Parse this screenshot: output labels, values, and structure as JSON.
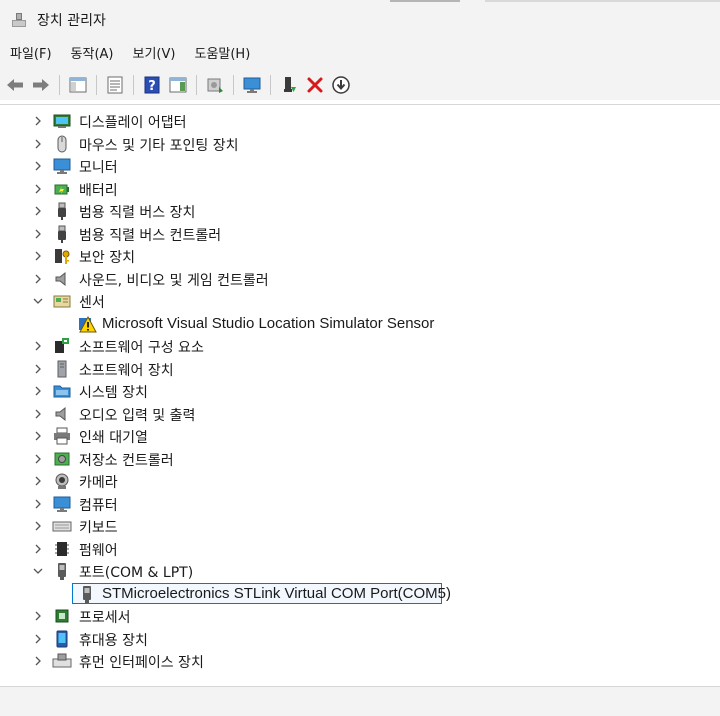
{
  "window": {
    "title": "장치 관리자"
  },
  "menu": {
    "items": [
      "파일(F)",
      "동작(A)",
      "보기(V)",
      "도움말(H)"
    ]
  },
  "toolbar": {
    "buttons": [
      "back-arrow-icon",
      "forward-arrow-icon",
      "show-hide-tree-icon",
      "properties-icon",
      "help-icon",
      "view-pane-icon",
      "scan-hardware-icon",
      "monitor-icon",
      "add-driver-icon",
      "uninstall-x-icon",
      "download-driver-icon"
    ]
  },
  "tree": {
    "nodes": [
      {
        "label": "디스플레이 어댑터",
        "icon": "display-adapter-icon",
        "expanded": false,
        "level": 0
      },
      {
        "label": "마우스 및 기타 포인팅 장치",
        "icon": "mouse-icon",
        "expanded": false,
        "level": 0
      },
      {
        "label": "모니터",
        "icon": "monitor-icon",
        "expanded": false,
        "level": 0
      },
      {
        "label": "배터리",
        "icon": "battery-icon",
        "expanded": false,
        "level": 0
      },
      {
        "label": "범용 직렬 버스 장치",
        "icon": "usb-icon",
        "expanded": false,
        "level": 0
      },
      {
        "label": "범용 직렬 버스 컨트롤러",
        "icon": "usb-icon",
        "expanded": false,
        "level": 0
      },
      {
        "label": "보안 장치",
        "icon": "security-key-icon",
        "expanded": false,
        "level": 0
      },
      {
        "label": "사운드, 비디오 및 게임 컨트롤러",
        "icon": "speaker-icon",
        "expanded": false,
        "level": 0
      },
      {
        "label": "센서",
        "icon": "sensor-icon",
        "expanded": true,
        "level": 0
      },
      {
        "label": "Microsoft Visual Studio Location Simulator Sensor",
        "icon": "warning-sensor-icon",
        "expanded": null,
        "level": 1
      },
      {
        "label": "소프트웨어 구성 요소",
        "icon": "software-component-icon",
        "expanded": false,
        "level": 0
      },
      {
        "label": "소프트웨어 장치",
        "icon": "software-device-icon",
        "expanded": false,
        "level": 0
      },
      {
        "label": "시스템 장치",
        "icon": "system-folder-icon",
        "expanded": false,
        "level": 0
      },
      {
        "label": "오디오 입력 및 출력",
        "icon": "speaker-icon",
        "expanded": false,
        "level": 0
      },
      {
        "label": "인쇄 대기열",
        "icon": "printer-icon",
        "expanded": false,
        "level": 0
      },
      {
        "label": "저장소 컨트롤러",
        "icon": "storage-controller-icon",
        "expanded": false,
        "level": 0
      },
      {
        "label": "카메라",
        "icon": "camera-icon",
        "expanded": false,
        "level": 0
      },
      {
        "label": "컴퓨터",
        "icon": "computer-icon",
        "expanded": false,
        "level": 0
      },
      {
        "label": "키보드",
        "icon": "keyboard-icon",
        "expanded": false,
        "level": 0
      },
      {
        "label": "펌웨어",
        "icon": "firmware-chip-icon",
        "expanded": false,
        "level": 0
      },
      {
        "label": "포트(COM & LPT)",
        "icon": "port-connector-icon",
        "expanded": true,
        "level": 0
      },
      {
        "label": "STMicroelectronics STLink Virtual COM Port(COM5)",
        "icon": "port-connector-icon",
        "expanded": null,
        "level": 1,
        "selected": true
      },
      {
        "label": "프로세서",
        "icon": "processor-icon",
        "expanded": false,
        "level": 0
      },
      {
        "label": "휴대용 장치",
        "icon": "portable-device-icon",
        "expanded": false,
        "level": 0
      },
      {
        "label": "휴먼 인터페이스 장치",
        "icon": "hid-icon",
        "expanded": false,
        "level": 0
      }
    ]
  },
  "colors": {
    "accent": "#0078d4",
    "chrome": "#f3f3f3",
    "text": "#1a1a1a"
  }
}
